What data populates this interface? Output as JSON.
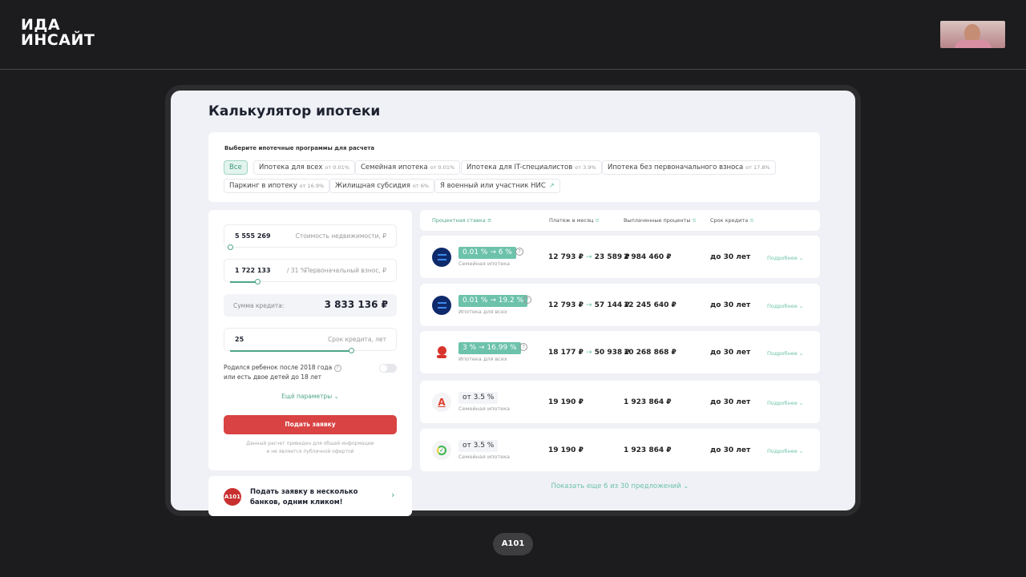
{
  "header": {
    "logo_line1": "ИДА",
    "logo_line2": "ИНСАЙТ"
  },
  "page": {
    "title": "Калькулятор ипотеки"
  },
  "programs": {
    "label": "Выберите ипотечные программы для расчета",
    "chips": [
      {
        "label": "Все",
        "rate": ""
      },
      {
        "label": "Ипотека для всех",
        "rate": "от 0.01%"
      },
      {
        "label": "Семейная ипотека",
        "rate": "от 0.01%"
      },
      {
        "label": "Ипотека для IT-специалистов",
        "rate": "от 3.9%"
      },
      {
        "label": "Ипотека без первоначального взноса",
        "rate": "от 17.8%"
      },
      {
        "label": "Паркинг в ипотеку",
        "rate": "от 16.9%"
      },
      {
        "label": "Жилищная субсидия",
        "rate": "от 6%"
      },
      {
        "label": "Я военный или участник НИС",
        "rate": ""
      }
    ]
  },
  "calc": {
    "price_value": "5 555 269",
    "price_label": "Стоимость недвижимости, ₽",
    "down_value": "1 722 133",
    "down_pct": "/ 31 %",
    "down_label": "Первоначальный взнос, ₽",
    "loan_label": "Сумма кредита:",
    "loan_value": "3 833 136 ₽",
    "term_value": "25",
    "term_label": "Срок кредита, лет",
    "child_label_1": "Родился ребенок после 2018 года",
    "child_label_2": "или есть двое детей до 18 лет",
    "child_toggle": false,
    "more_params": "Ещё параметры",
    "submit": "Подать заявку",
    "disclaimer_1": "Данный расчет приведен для общей информации",
    "disclaimer_2": "и не является публичной офертой"
  },
  "promo": {
    "badge": "A101",
    "text_1": "Подать заявку в несколько",
    "text_2": "банков, одним кликом!"
  },
  "table": {
    "headers": [
      "Процентная ставка",
      "Платеж в месяц",
      "Выплаченные проценты",
      "Срок кредита"
    ],
    "rows": [
      {
        "bank_icon": "vtb-logo",
        "rate": "0.01 % → 6 %",
        "program": "Семейная ипотека",
        "pay_from": "12 793 ₽",
        "pay_to": "23 589 ₽",
        "interest": "2 984 460 ₽",
        "term": "до 30 лет",
        "more": "Подробнее"
      },
      {
        "bank_icon": "vtb-logo",
        "rate": "0.01 % → 19.2 %",
        "program": "Ипотека для всех",
        "pay_from": "12 793 ₽",
        "pay_to": "57 144 ₽",
        "interest": "12 245 640 ₽",
        "term": "до 30 лет",
        "more": "Подробнее"
      },
      {
        "bank_icon": "sovcombank-logo",
        "rate": "3 % → 16.99 %",
        "program": "Ипотека для всех",
        "pay_from": "18 177 ₽",
        "pay_to": "50 938 ₽",
        "interest": "10 268 868 ₽",
        "term": "до 30 лет",
        "more": "Подробнее"
      },
      {
        "bank_icon": "alfa-logo",
        "rate": "от 3.5 %",
        "program": "Семейная ипотека",
        "pay_from": "19 190 ₽",
        "pay_to": "",
        "interest": "1 923 864 ₽",
        "term": "до 30 лет",
        "more": "Подробнее"
      },
      {
        "bank_icon": "sber-logo",
        "rate": "от 3.5 %",
        "program": "Семейная ипотека",
        "pay_from": "19 190 ₽",
        "pay_to": "",
        "interest": "1 923 864 ₽",
        "term": "до 30 лет",
        "more": "Подробнее"
      }
    ],
    "show_more": "Показать еще 6 из 30 предложений"
  },
  "footer": {
    "badge": "A101"
  },
  "colors": {
    "accent": "#6cc2aa",
    "submit": "#d94343",
    "background": "#1c1b1d"
  }
}
